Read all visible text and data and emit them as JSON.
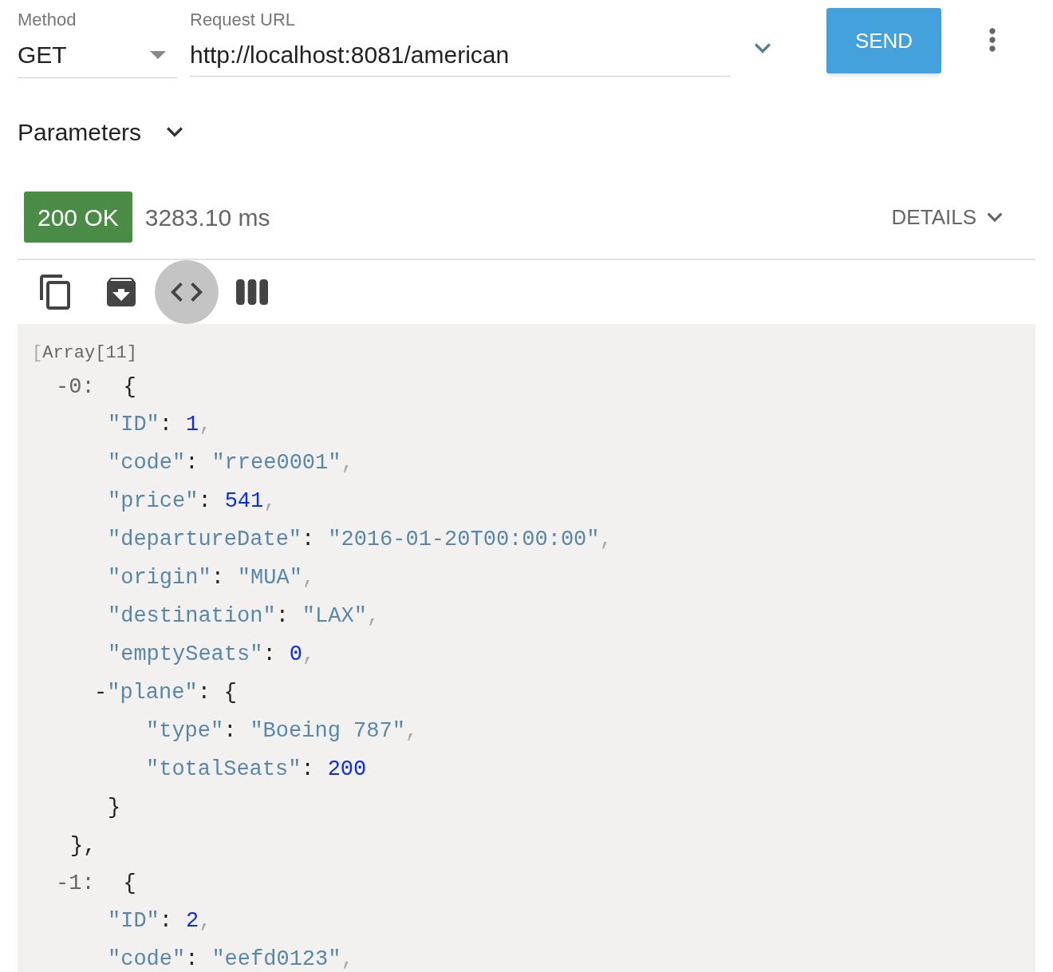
{
  "request": {
    "method_label": "Method",
    "method": "GET",
    "url_label": "Request URL",
    "url": "http://localhost:8081/american",
    "send": "SEND"
  },
  "parameters": {
    "label": "Parameters",
    "expanded": false
  },
  "response": {
    "status": "200 OK",
    "time": "3283.10 ms",
    "details": "DETAILS"
  },
  "view_buttons": [
    {
      "kind": "copy",
      "selected": false
    },
    {
      "kind": "save",
      "selected": false
    },
    {
      "kind": "code",
      "selected": true
    },
    {
      "kind": "columns",
      "selected": false
    }
  ],
  "body": {
    "bracket": "[",
    "summary": "Array[11]",
    "items": [
      {
        "label": "-0:",
        "open": "{",
        "close": "},",
        "entries": [
          {
            "kind": "number",
            "key": "\"ID\"",
            "sep": ":",
            "value": "1",
            "comma": ","
          },
          {
            "kind": "string",
            "key": "\"code\"",
            "sep": ":",
            "value": "\"rree0001\"",
            "comma": ","
          },
          {
            "kind": "number",
            "key": "\"price\"",
            "sep": ":",
            "value": "541",
            "comma": ","
          },
          {
            "kind": "string",
            "key": "\"departureDate\"",
            "sep": ":",
            "value": "\"2016-01-20T00:00:00\"",
            "comma": ","
          },
          {
            "kind": "string",
            "key": "\"origin\"",
            "sep": ":",
            "value": "\"MUA\"",
            "comma": ","
          },
          {
            "kind": "string",
            "key": "\"destination\"",
            "sep": ":",
            "value": "\"LAX\"",
            "comma": ","
          },
          {
            "kind": "number",
            "key": "\"emptySeats\"",
            "sep": ":",
            "value": "0",
            "comma": ","
          },
          {
            "kind": "object",
            "toggle": "-",
            "key": "\"plane\"",
            "sep": ":",
            "open": "{",
            "close": "}",
            "children": [
              {
                "kind": "string",
                "key": "\"type\"",
                "sep": ":",
                "value": "\"Boeing 787\"",
                "comma": ","
              },
              {
                "kind": "number",
                "key": "\"totalSeats\"",
                "sep": ":",
                "value": "200"
              }
            ]
          }
        ]
      },
      {
        "label": "-1:",
        "open": "{",
        "entries": [
          {
            "kind": "number",
            "key": "\"ID\"",
            "sep": ":",
            "value": "2",
            "comma": ","
          },
          {
            "kind": "string",
            "key": "\"code\"",
            "sep": ":",
            "value": "\"eefd0123\"",
            "comma": ","
          }
        ]
      }
    ]
  }
}
